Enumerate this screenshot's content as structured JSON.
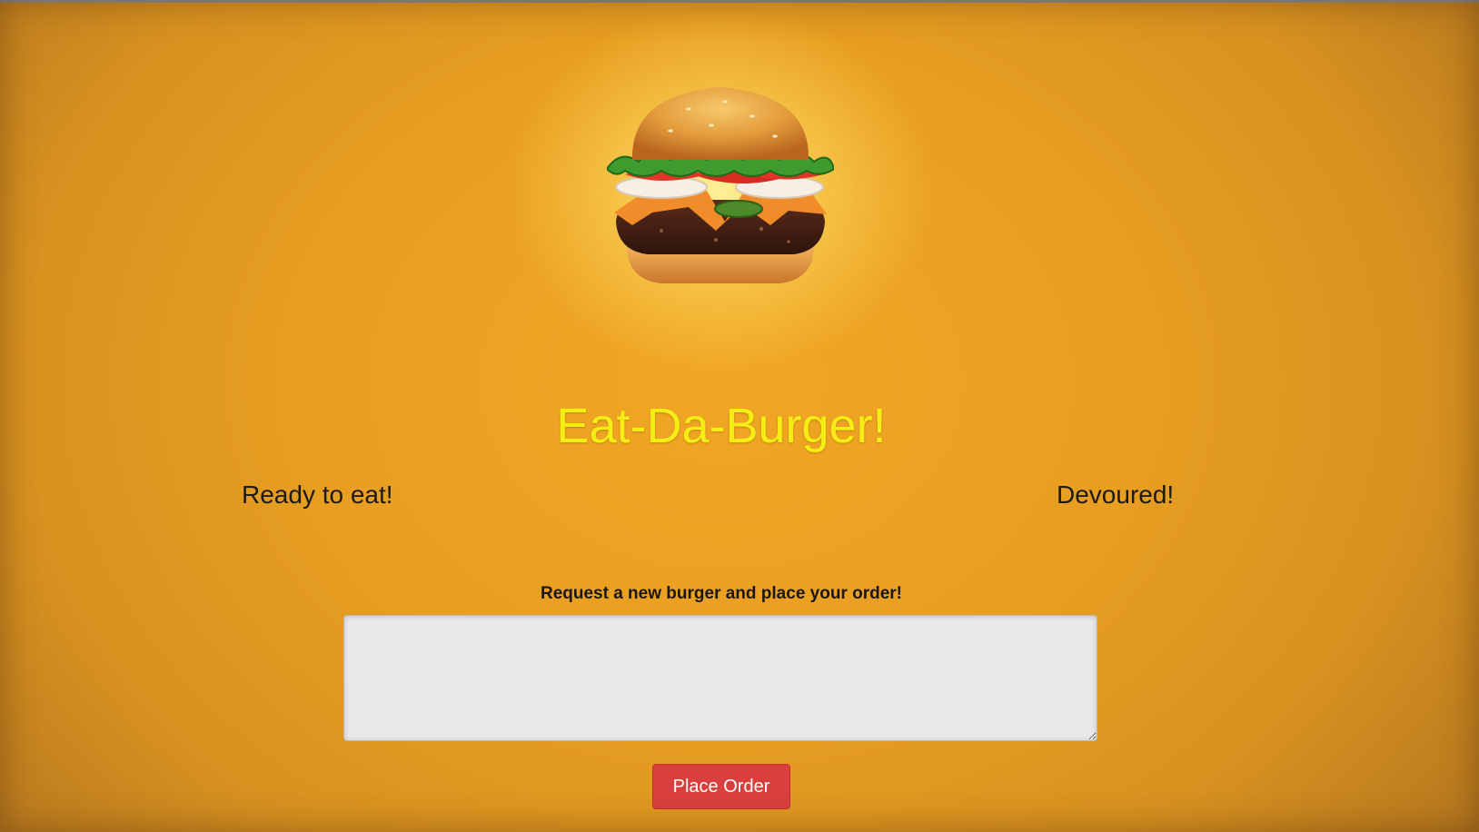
{
  "header": {
    "title": "Eat-Da-Burger!",
    "title_color": "#f5ee15"
  },
  "hero": {
    "icon": "hamburger-icon"
  },
  "columns": {
    "ready_label": "Ready to eat!",
    "devoured_label": "Devoured!"
  },
  "order_form": {
    "label": "Request a new burger and place your order!",
    "input_value": "",
    "input_placeholder": "",
    "submit_label": "Place Order",
    "submit_color": "#d9403d"
  },
  "colors": {
    "background": "#e89e21",
    "text": "#1d1a14"
  }
}
